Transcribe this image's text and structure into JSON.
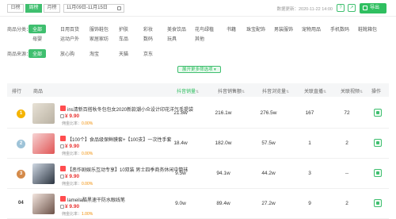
{
  "toolbar": {
    "tabs": [
      "日榜",
      "周榜",
      "月榜"
    ],
    "active_tab": "周榜",
    "date_range": "11月09日-11月15日",
    "updated": "数据更新：2020-11-22 14:00",
    "export_label": "导出"
  },
  "filters": {
    "category_label": "商品分类：",
    "categories_row1": [
      "全部",
      "日用百货",
      "服饰鞋包",
      "护肤",
      "彩妆",
      "美食饮品",
      "花鸟绿植",
      "书籍",
      "珠宝配饰",
      "男装服饰",
      "宠物用品",
      "手机数码",
      "鞋靴箱包"
    ],
    "categories_row2": [
      "母婴",
      "运动户外",
      "家居家纺",
      "车品",
      "数码",
      "玩具",
      "其他"
    ],
    "source_label": "商品来源：",
    "sources": [
      "全部",
      "放心购",
      "淘宝",
      "天猫",
      "京东"
    ],
    "expand_label": "展开更多筛选项 ▾"
  },
  "table": {
    "headers": [
      "排行",
      "商品",
      "抖音销量",
      "抖音销售额",
      "抖音浏览量",
      "关联直播",
      "关联视频",
      "操作"
    ],
    "rows": [
      {
        "rank": "1",
        "title": "ins清新百搭秋冬包包女2020新款潮小众设计印花洋气手提袋",
        "price": "¥ 9.90",
        "commission_label": "佣金比率：",
        "commission": "0.00%",
        "sales": "21.8w",
        "revenue": "216.1w",
        "views": "276.5w",
        "live": "167",
        "videos": "72"
      },
      {
        "rank": "2",
        "title": "【100个】食品级保鲜膜套+【100支】一次性手套",
        "price": "¥ 9.90",
        "commission_label": "佣金比率：",
        "commission": "0.00%",
        "sales": "18.4w",
        "revenue": "182.0w",
        "views": "57.5w",
        "live": "1",
        "videos": "2"
      },
      {
        "rank": "3",
        "title": "【恶作剧娱乐互动专享】10双装 男士四季商务休闲中筒袜",
        "price": "¥ 9.90",
        "commission_label": "佣金比率：",
        "commission": "0.00%",
        "sales": "9.5w",
        "revenue": "94.1w",
        "views": "44.2w",
        "live": "3",
        "videos": "--"
      },
      {
        "rank": "04",
        "title": "lameila酷黑速干防水眼线笔",
        "price": "¥ 9.90",
        "commission_label": "佣金比率：",
        "commission": "1.00%",
        "sales": "9.0w",
        "revenue": "89.4w",
        "views": "27.2w",
        "live": "9",
        "videos": "2"
      }
    ]
  },
  "colors": {
    "accent": "#3fbf6f",
    "price": "#e8302e",
    "medal_gold": "#f5b400",
    "medal_silver": "#9ec3d8",
    "medal_bronze": "#d48a4a"
  }
}
